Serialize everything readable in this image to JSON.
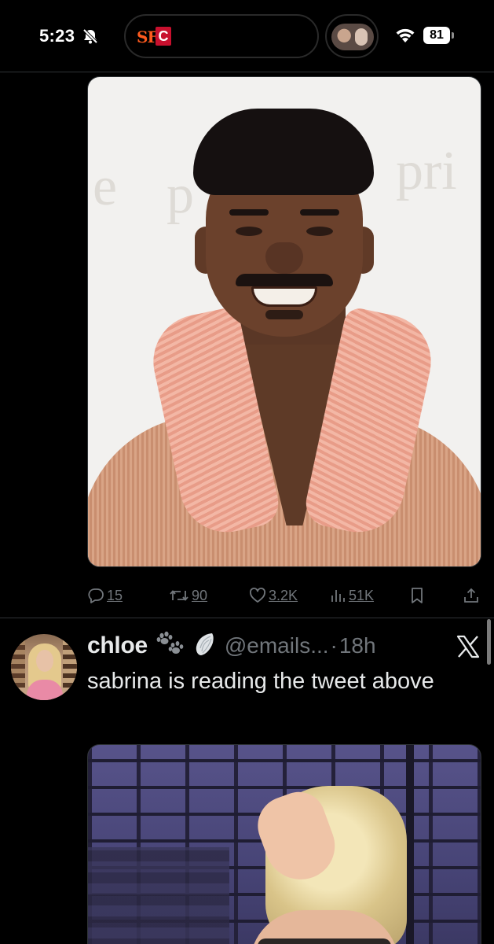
{
  "status_bar": {
    "time": "5:23",
    "battery": "81",
    "icons": [
      "bell-slash-icon",
      "sf-giants-logo",
      "cleveland-c-logo",
      "live-activity-thumbnail",
      "wifi-icon",
      "battery-icon"
    ],
    "sf_logo_text": "SF",
    "c_logo_text": "C"
  },
  "tweet_1": {
    "media": {
      "description_icon": "photo-man-smiling-pink-shawl-sweater",
      "background_text_1": "e",
      "background_text_2": "p",
      "background_text_3": "pri"
    },
    "actions": {
      "replies": "15",
      "reposts": "90",
      "likes": "3.2K",
      "views": "51K"
    }
  },
  "tweet_2": {
    "author_name": "chloe",
    "emojis": [
      "paw-prints-emoji",
      "wing-emoji"
    ],
    "handle": "@emails...",
    "separator": "·",
    "time": "18h",
    "text": "sabrina is reading the tweet above",
    "media": {
      "description_icon": "photo-blonde-woman-looking-up"
    }
  },
  "colors": {
    "background": "#000000",
    "text_primary": "#e7e9ea",
    "text_secondary": "#71767b",
    "divider": "#2f3336"
  }
}
